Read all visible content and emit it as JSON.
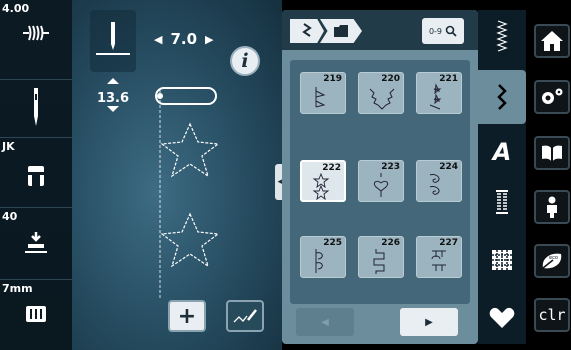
{
  "left": {
    "thread_tension": "4.00",
    "presser_foot_label": "JK",
    "presser_pressure": "40",
    "feed_dog": "7mm"
  },
  "controls": {
    "stitch_width": "7.0",
    "stitch_length": "13.6",
    "info": "i",
    "plus": "+"
  },
  "panel": {
    "search_label": "0-9",
    "stitches": [
      {
        "number": "219"
      },
      {
        "number": "220"
      },
      {
        "number": "221"
      },
      {
        "number": "222"
      },
      {
        "number": "223"
      },
      {
        "number": "224"
      },
      {
        "number": "225"
      },
      {
        "number": "226"
      },
      {
        "number": "227"
      }
    ],
    "selected": "222"
  },
  "categories": [
    "practical-stitches-icon",
    "decorative-stitches-icon",
    "alphabets-icon",
    "buttonholes-icon",
    "quilt-stitches-icon",
    "personal-program-icon"
  ],
  "system": {
    "clr_label": "clr",
    "eco_label": "eco"
  },
  "colors": {
    "panel_bg": "#6c8d9c",
    "main_bg": "#2d5a70",
    "selected_cell": "#dde7ec"
  }
}
